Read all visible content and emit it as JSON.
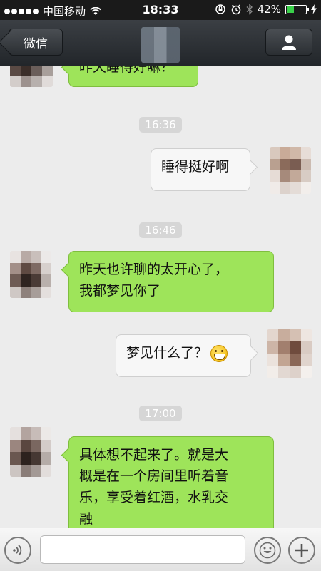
{
  "status_bar": {
    "carrier": "中国移动",
    "time": "18:33",
    "battery": "42%",
    "battery_level": 0.42
  },
  "nav": {
    "back_label": "微信"
  },
  "messages": [
    {
      "text": "昨天睡得好嘛？"
    },
    {
      "text": "睡得挺好啊"
    },
    {
      "text": "昨天也许聊的太开心了，\n我都梦见你了"
    },
    {
      "text": "梦见什么了？"
    },
    {
      "text": "具体想不起来了。就是大\n概是在一个房间里听着音\n乐，享受着红酒，水乳交\n融"
    }
  ],
  "timestamps": [
    "16:36",
    "16:46",
    "17:00"
  ],
  "input": {
    "placeholder": ""
  },
  "colors": {
    "incoming_bubble": "#9ee45a",
    "outgoing_bubble": "#f7f7f7",
    "navbar": "#2b2f33",
    "background": "#ececec"
  },
  "icons": [
    "signal-icon",
    "wifi-icon",
    "rotation-lock-icon",
    "alarm-icon",
    "bluetooth-icon",
    "battery-icon",
    "charging-icon",
    "profile-icon",
    "voice-icon",
    "emoji-icon",
    "plus-icon",
    "grin-emoji-icon"
  ]
}
